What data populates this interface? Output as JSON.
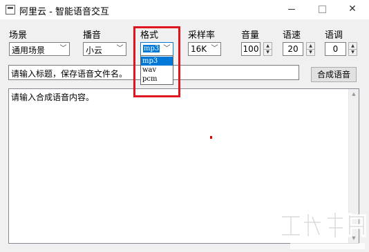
{
  "window": {
    "title": "阿里云 - 智能语音交互"
  },
  "scene": {
    "label": "场景",
    "value": "通用场景"
  },
  "voice": {
    "label": "播音",
    "value": "小云"
  },
  "format": {
    "label": "格式",
    "value": "mp3",
    "options": [
      "mp3",
      "wav",
      "pcm"
    ]
  },
  "sample_rate": {
    "label": "采样率",
    "value": "16K"
  },
  "volume": {
    "label": "音量",
    "value": "100"
  },
  "speed": {
    "label": "语速",
    "value": "20"
  },
  "pitch": {
    "label": "语调",
    "value": "0"
  },
  "title_input": {
    "placeholder": "请输入标题，保存语音文件名。"
  },
  "synth_button": {
    "label": "合成语音"
  },
  "content_input": {
    "placeholder": "请输入合成语音内容。"
  },
  "colors": {
    "highlight": "#e0141e",
    "selection": "#0078d7"
  }
}
